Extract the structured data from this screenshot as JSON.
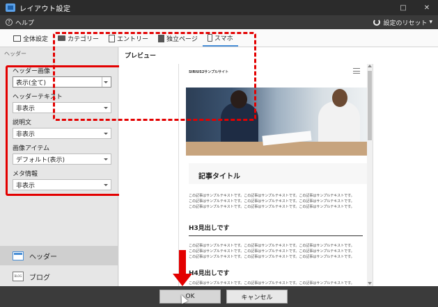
{
  "window": {
    "title": "レイアウト設定",
    "minimize_symbol": "□",
    "close_symbol": "✕"
  },
  "menubar": {
    "help_label": "ヘルプ",
    "reset_label": "設定のリセット",
    "reset_caret": "▾"
  },
  "tabs": [
    {
      "label": "全体設定",
      "icon": "monitor-icon"
    },
    {
      "label": "カテゴリー",
      "icon": "folder-icon"
    },
    {
      "label": "エントリー",
      "icon": "document-icon"
    },
    {
      "label": "独立ページ",
      "icon": "page-icon"
    },
    {
      "label": "スマホ",
      "icon": "smartphone-icon",
      "active": true
    }
  ],
  "left_panel": {
    "section_label": "ヘッダー",
    "fields": [
      {
        "label": "ヘッダー画像",
        "value": "表示(全て)"
      },
      {
        "label": "ヘッダーテキスト",
        "value": "非表示"
      },
      {
        "label": "説明文",
        "value": "非表示"
      },
      {
        "label": "画像アイテム",
        "value": "デフォルト(表示)"
      },
      {
        "label": "メタ情報",
        "value": "非表示"
      }
    ],
    "nav": [
      {
        "label": "ヘッダー",
        "icon": "header-layout-icon",
        "active": true
      },
      {
        "label": "ブログ",
        "icon": "blog-icon",
        "icon_text": "BLOG"
      }
    ]
  },
  "preview": {
    "label": "プレビュー",
    "site_name": "SIRIUS2サンプルサイト",
    "article_title": "記事タイトル",
    "paragraph_line": "この記事はサンプルテキストです。この記事はサンプルテキストです。この記事はサンプルテキストです。",
    "h3": "H3見出しです",
    "h4": "H4見出しです"
  },
  "buttons": {
    "ok": "OK",
    "cancel": "キャンセル"
  },
  "colors": {
    "highlight_red": "#e30000",
    "accent_blue": "#4a90d9",
    "titlebar": "#2b2b2b"
  }
}
